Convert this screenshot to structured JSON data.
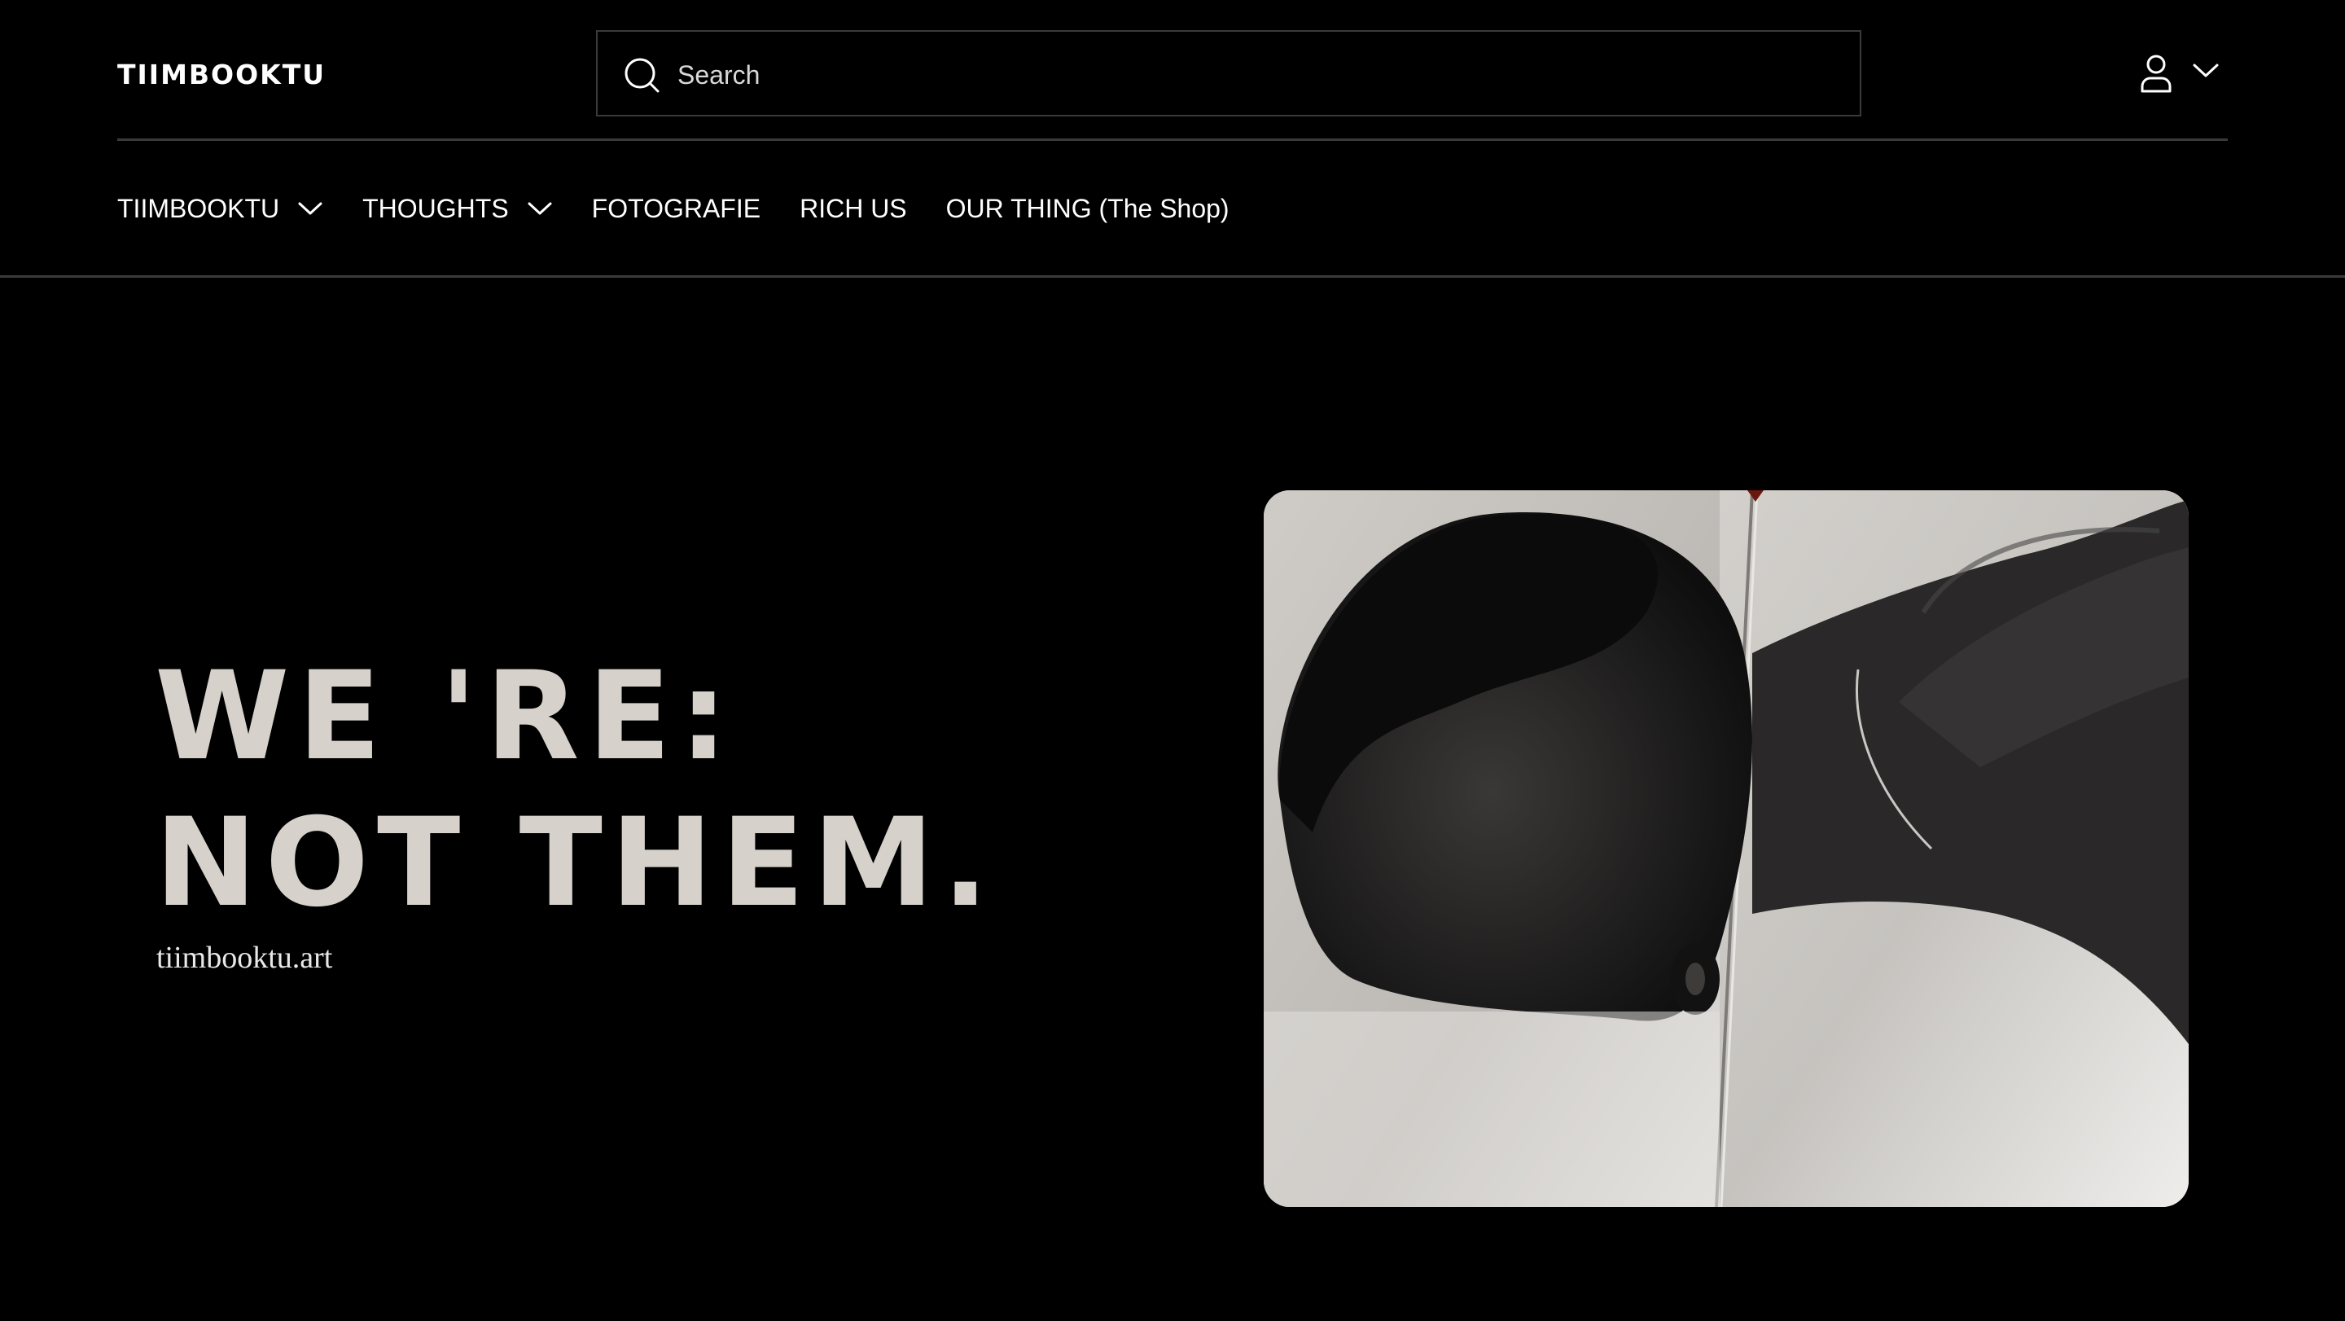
{
  "header": {
    "logo": "TIIMBOOKTU",
    "search": {
      "placeholder": "Search",
      "icon": "search-icon"
    },
    "account": {
      "icon": "user-icon",
      "chevron": "chevron-down-icon"
    }
  },
  "nav": {
    "items": [
      {
        "label": "TIIMBOOKTU",
        "has_dropdown": true
      },
      {
        "label": "THOUGHTS",
        "has_dropdown": true
      },
      {
        "label": "FOTOGRAFIE",
        "has_dropdown": false
      },
      {
        "label": "RICH US",
        "has_dropdown": false
      },
      {
        "label": "OUR THING (The Shop)",
        "has_dropdown": false
      }
    ]
  },
  "hero": {
    "heading_line1": "WE 'RE:",
    "heading_line2": "NOT THEM.",
    "subtitle": "tiimbooktu.art"
  },
  "colors": {
    "background": "#000000",
    "text": "#ffffff",
    "heading": "#d6d1cb",
    "divider": "#3a3a3a"
  }
}
